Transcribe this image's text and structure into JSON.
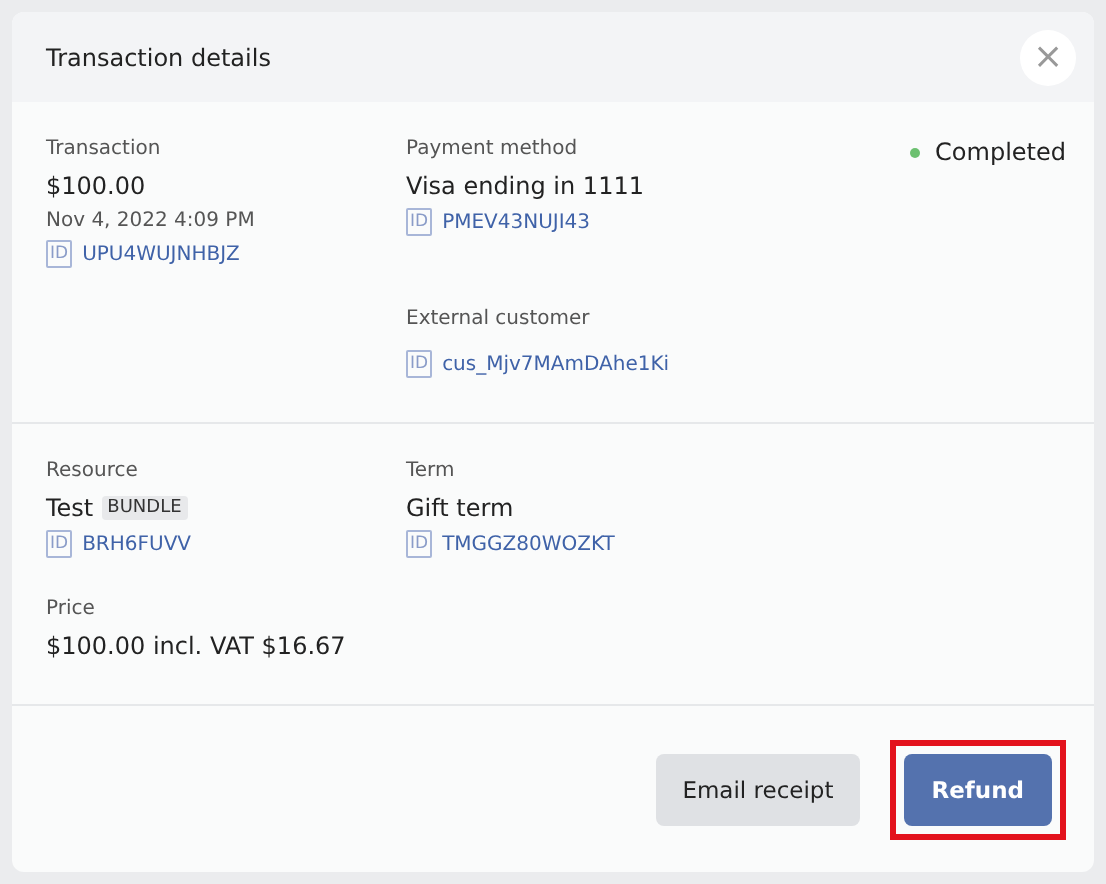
{
  "dialog": {
    "title": "Transaction details",
    "close_icon": "×"
  },
  "sections": [
    {
      "fields": [
        {
          "label": "Transaction",
          "value": "$100.00",
          "sub": "Nov 4, 2022 4:09 PM",
          "id_badge": "ID",
          "id": "UPU4WUJNHBJZ"
        },
        {
          "label": "Payment method",
          "value": "Visa ending in 1111",
          "id_badge": "ID",
          "id": "PMEV43NUJI43"
        },
        {
          "kind": "status",
          "value": "Completed",
          "color": "#6cc070"
        },
        {
          "kind": "spacer"
        },
        {
          "label": "External customer",
          "id_badge": "ID",
          "id": "cus_Mjv7MAmDAhe1Ki"
        }
      ]
    },
    {
      "fields": [
        {
          "label": "Resource",
          "value": "Test",
          "tag": "BUNDLE",
          "id_badge": "ID",
          "id": "BRH6FUVV"
        },
        {
          "label": "Term",
          "value": "Gift term",
          "id_badge": "ID",
          "id": "TMGGZ80WOZKT"
        },
        {
          "kind": "spacer"
        },
        {
          "label": "Price",
          "value": "$100.00 incl. VAT $16.67"
        }
      ]
    }
  ],
  "buttons": [
    {
      "label": "Email receipt",
      "kind": "secondary",
      "highlighted": false
    },
    {
      "label": "Refund",
      "kind": "primary",
      "highlighted": true
    }
  ]
}
